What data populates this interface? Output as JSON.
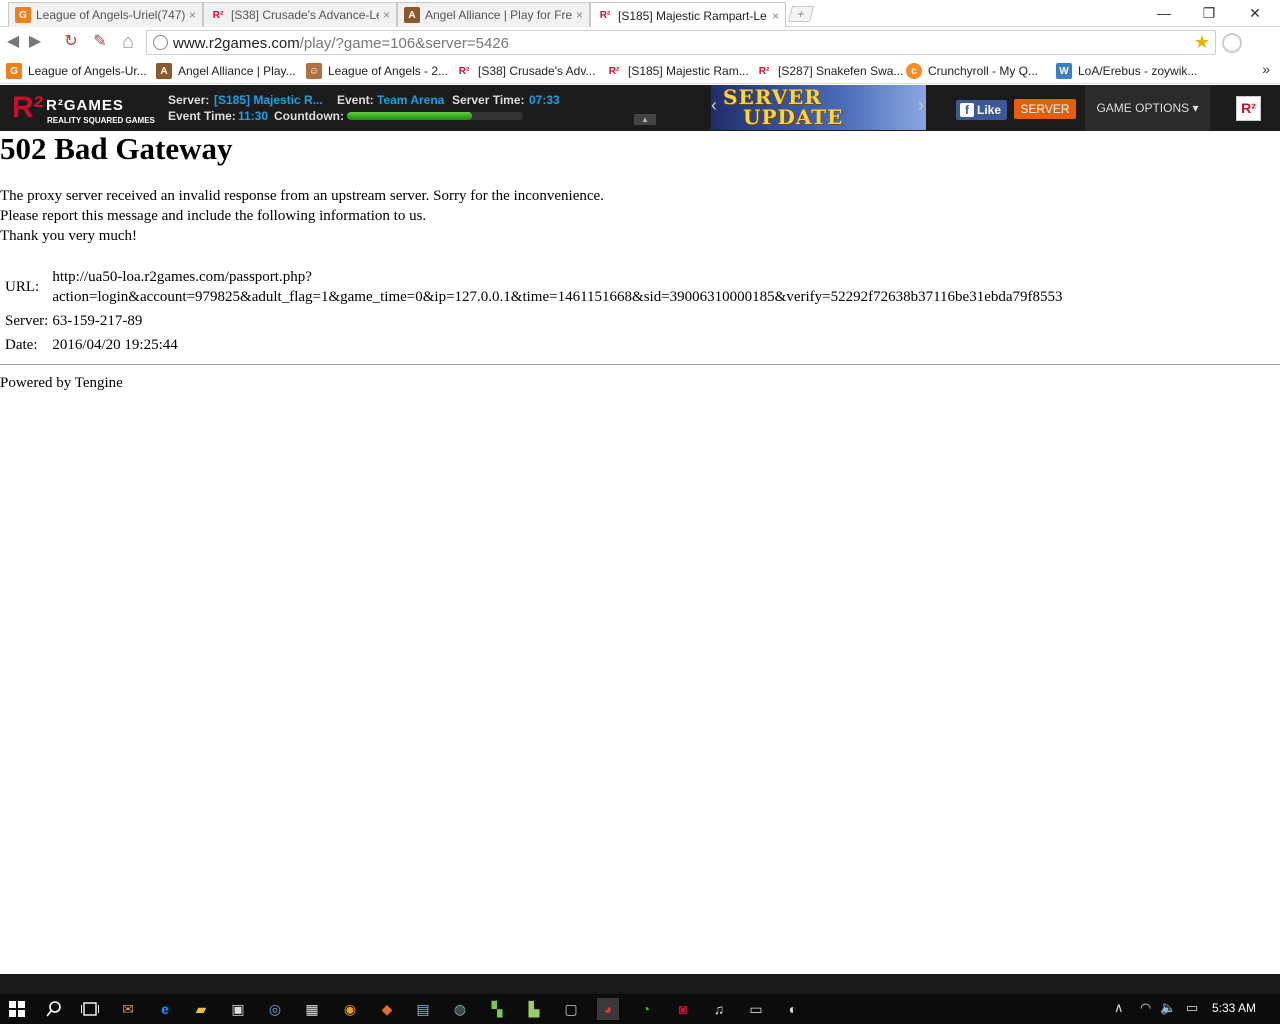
{
  "browser": {
    "tabs": [
      {
        "title": "League of Angels-Uriel(747)",
        "icon": "loa-favicon",
        "color": "#f0801a",
        "active": false
      },
      {
        "title": "[S38] Crusade's Advance-Le",
        "icon": "r2-favicon",
        "color": "#c8102e",
        "active": false
      },
      {
        "title": "Angel Alliance | Play for Fre",
        "icon": "angel-alliance-favicon",
        "color": "#8a5a2a",
        "active": false
      },
      {
        "title": "[S185] Majestic Rampart-Le",
        "icon": "r2-favicon",
        "color": "#c8102e",
        "active": true
      }
    ],
    "tab_close": "×",
    "new_tab": "+",
    "window": {
      "minimize": "—",
      "restore": "❐",
      "close": "✕"
    },
    "nav": {
      "back": "◀",
      "forward": "▶",
      "reload": "↻",
      "tools": "✎",
      "home": "⌂"
    },
    "address": {
      "host": "www.r2games.com",
      "path": "/play/?game=106&server=5426"
    },
    "bookmark_star": "★",
    "bookmarks": [
      {
        "label": "League of Angels-Ur...",
        "icon": "loa-favicon",
        "color": "#f0801a"
      },
      {
        "label": "Angel Alliance | Play...",
        "icon": "angel-alliance-favicon",
        "color": "#8a5a2a"
      },
      {
        "label": "League of Angels - 2...",
        "icon": "loa-girl-favicon",
        "color": "#b07040"
      },
      {
        "label": "[S38] Crusade's Adv...",
        "icon": "r2-favicon",
        "color": "#c8102e"
      },
      {
        "label": "[S185] Majestic Ram...",
        "icon": "r2-favicon",
        "color": "#c8102e"
      },
      {
        "label": "[S287] Snakefen Swa...",
        "icon": "r2-favicon",
        "color": "#c8102e"
      },
      {
        "label": "Crunchyroll - My Q...",
        "icon": "crunchyroll-favicon",
        "color": "#f78b24"
      },
      {
        "label": "LoA/Erebus - zoywik...",
        "icon": "wiki-favicon",
        "color": "#3a7fc4"
      }
    ],
    "bookmarks_more": "»"
  },
  "r2bar": {
    "logo_mark": "R²",
    "logo_name": "R²GAMES",
    "logo_sub": "REALITY SQUARED GAMES",
    "server_label": "Server:",
    "server_value": "[S185] Majestic R...",
    "event_label": "Event:",
    "event_value": "Team Arena",
    "server_time_label": "Server Time:",
    "server_time_value": "07:33",
    "event_time_label": "Event Time:",
    "event_time_value": "11:30",
    "countdown_label": "Countdown:",
    "countdown_fraction": 0.71,
    "collapse": "▲",
    "banner_line1": "SERVER",
    "banner_line2": "UPDATE",
    "banner_prev": "‹",
    "banner_next": "›",
    "fb_f": "f",
    "fb_like": "Like",
    "server_button": "SERVER",
    "game_options": "GAME OPTIONS ▾",
    "corner_icon": "R²",
    "accent": "#1ea0e6"
  },
  "error_page": {
    "title": "502 Bad Gateway",
    "lines": [
      "The proxy server received an invalid response from an upstream server. Sorry for the inconvenience.",
      "Please report this message and include the following information to us.",
      "Thank you very much!"
    ],
    "url_label": "URL:",
    "url_line1": "http://ua50-loa.r2games.com/passport.php?",
    "url_line2": "action=login&account=979825&adult_flag=1&game_time=0&ip=127.0.0.1&time=1461151668&sid=39006310000185&verify=52292f72638b37116be31ebda79f8553",
    "server_label": "Server:",
    "server_value": "63-159-217-89",
    "date_label": "Date:",
    "date_value": "2016/04/20 19:25:44",
    "footer": "Powered by Tengine"
  },
  "taskbar": {
    "clock": "5:33 AM",
    "tray_up": "∧",
    "tray_wifi": "◠",
    "tray_volume": "🔈",
    "tray_notify": "▭"
  }
}
